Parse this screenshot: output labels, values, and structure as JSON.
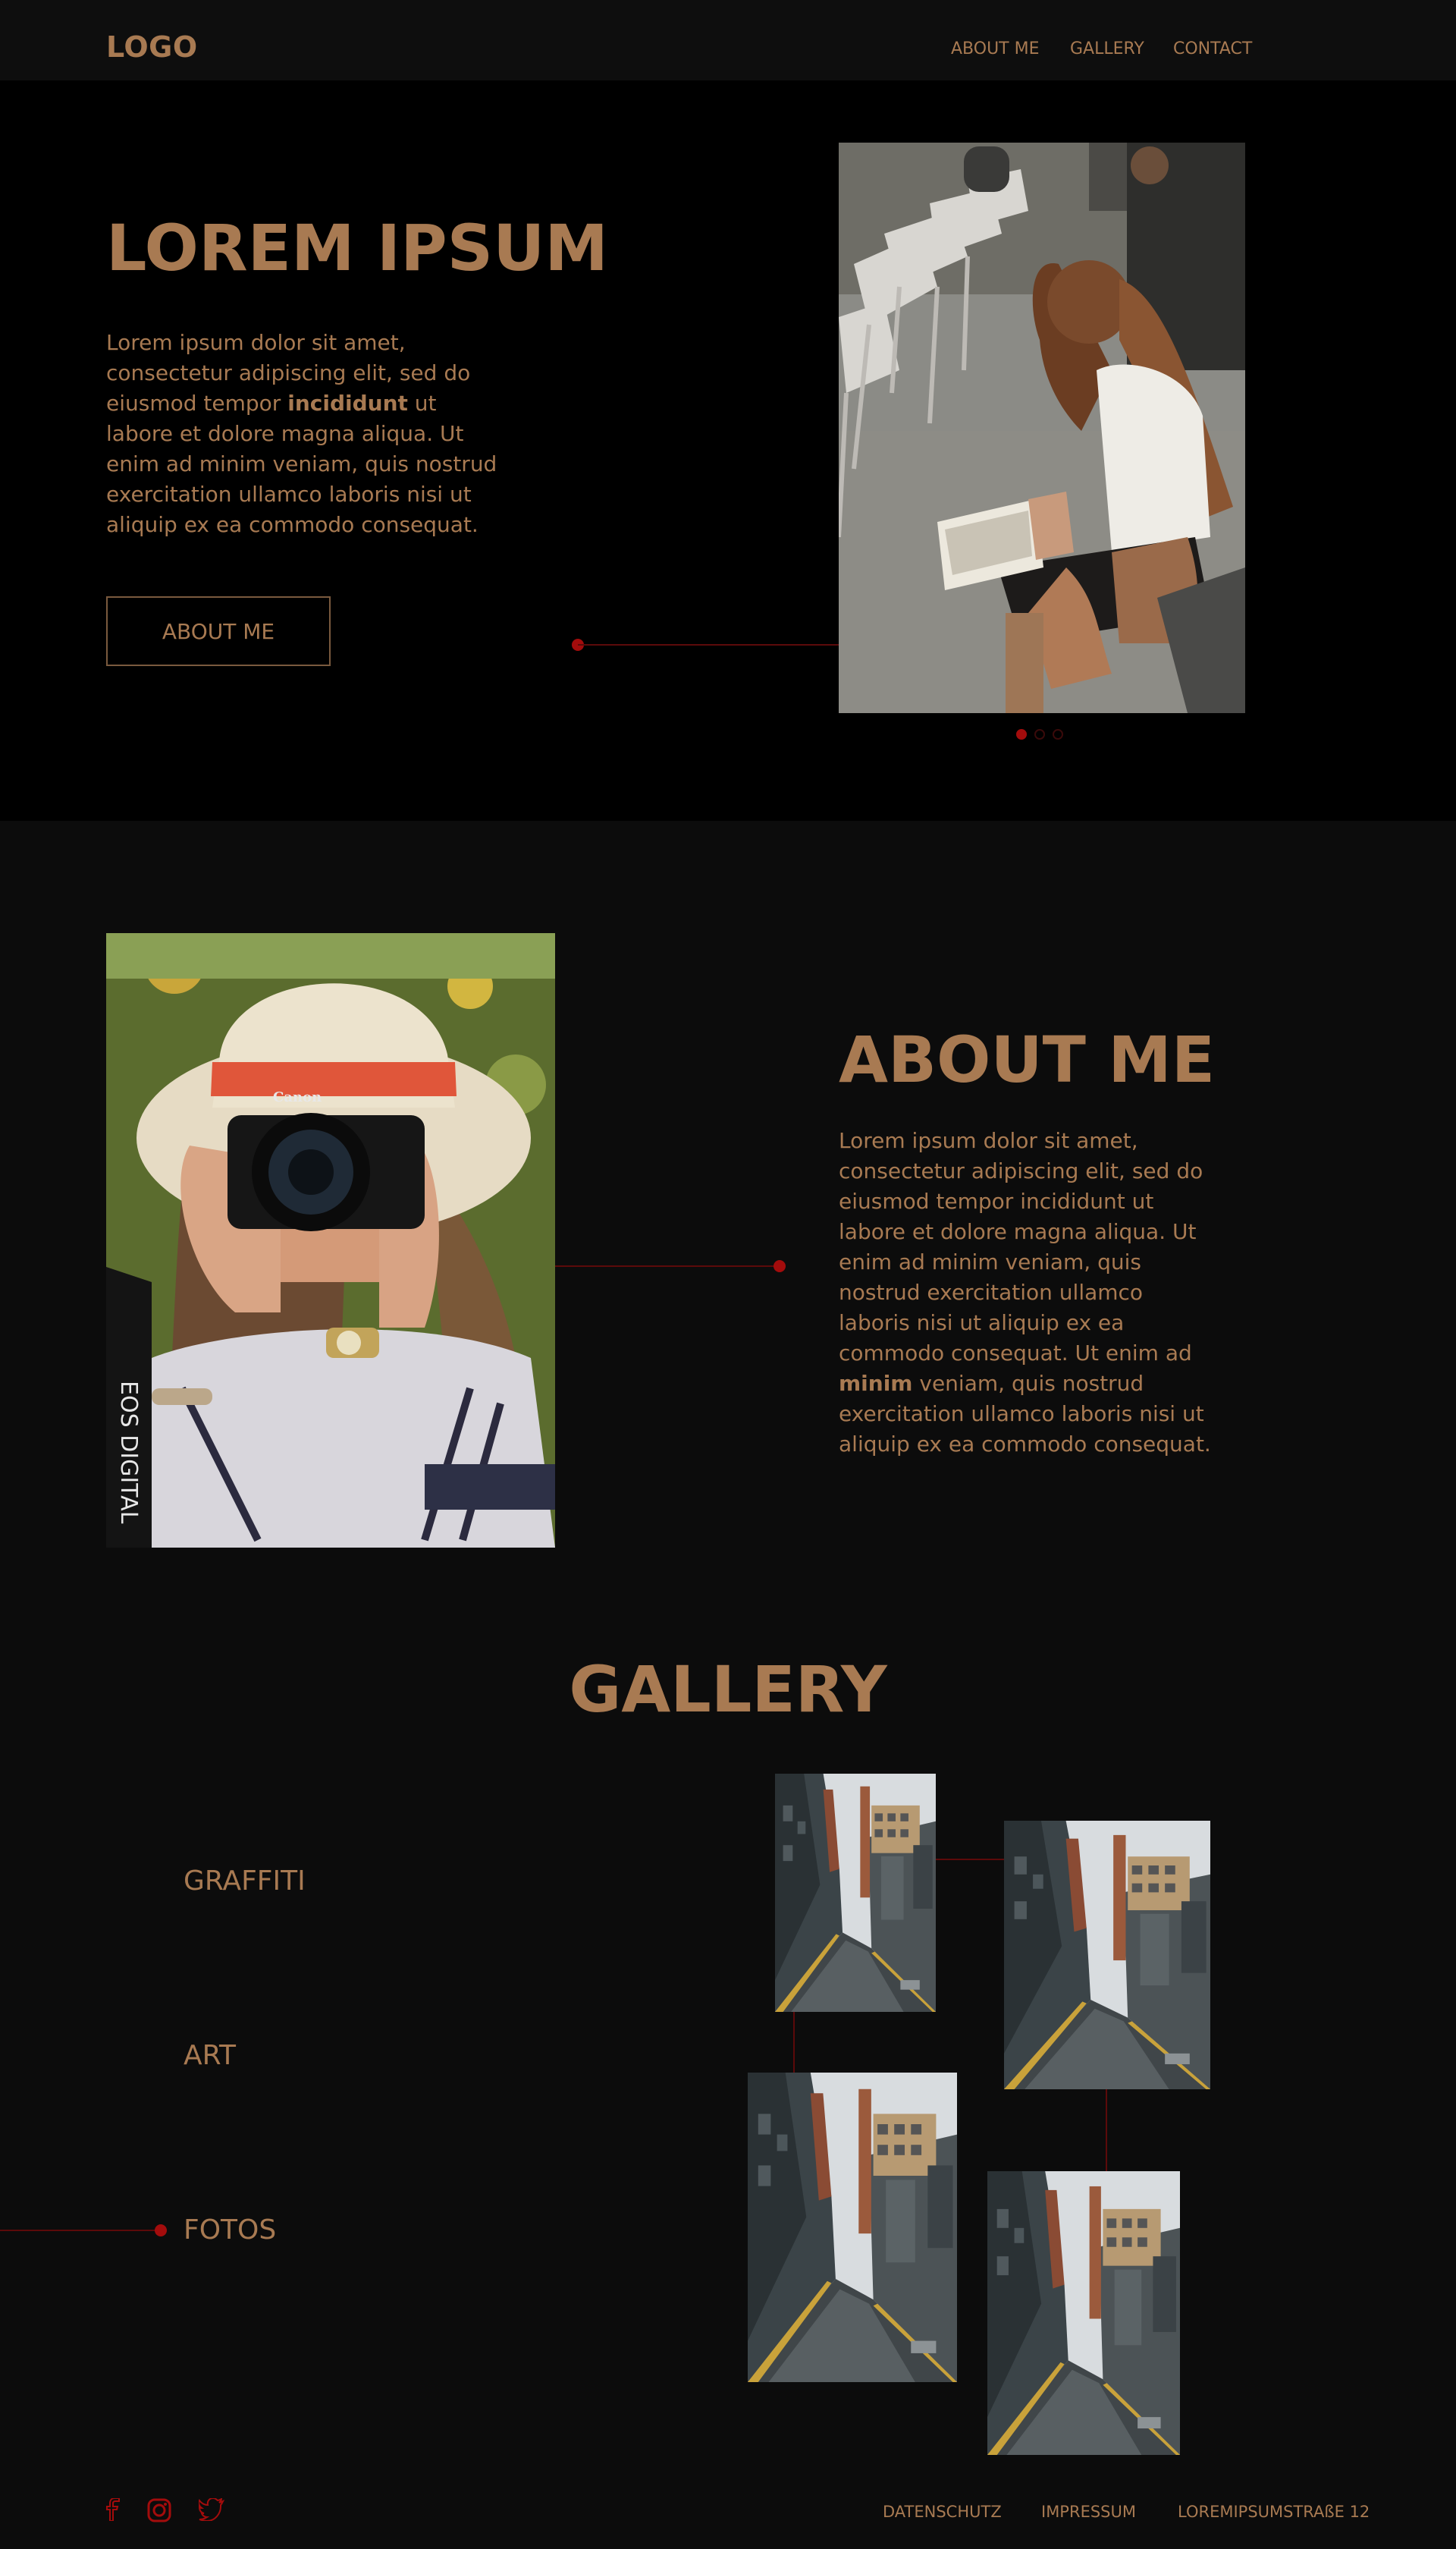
{
  "header": {
    "logo": "LOGO",
    "nav": [
      "ABOUT ME",
      "GALLERY",
      "CONTACT"
    ]
  },
  "hero": {
    "title": "LOREM IPSUM",
    "text_before": "Lorem ipsum dolor sit amet, consectetur adipiscing elit, sed do eiusmod tempor ",
    "text_bold": "incididunt",
    "text_after": " ut labore et dolore magna aliqua. Ut enim ad minim veniam, quis nostrud exercitation ullamco laboris nisi ut aliquip ex ea commodo consequat.",
    "button_label": "ABOUT ME",
    "slider_active_index": 0,
    "slider_count": 3
  },
  "about": {
    "title": "ABOUT ME",
    "text_before": "Lorem ipsum dolor sit amet, consectetur adipiscing elit, sed do eiusmod tempor incididunt ut labore et dolore magna aliqua. Ut enim ad minim veniam, quis nostrud exercitation ullamco laboris nisi ut aliquip ex ea commodo consequat. Ut enim ad ",
    "text_bold": "minim",
    "text_after": " veniam, quis nostrud exercitation ullamco laboris nisi ut aliquip ex ea commodo consequat.",
    "camera_strap_text": "EOS DIGITAL",
    "camera_brand": "Canon"
  },
  "gallery": {
    "title": "GALLERY",
    "categories": [
      "GRAFFITI",
      "ART",
      "FOTOS"
    ],
    "active_category": "FOTOS"
  },
  "footer": {
    "social": [
      "facebook-icon",
      "instagram-icon",
      "twitter-icon"
    ],
    "links": [
      "DATENSCHUTZ",
      "IMPRESSUM",
      "LOREMIPSUMSTRAßE 12"
    ]
  },
  "colors": {
    "accent": "#a87a52",
    "red": "#a30c0c",
    "background": "#0c0c0c",
    "hero_background": "#000000"
  }
}
